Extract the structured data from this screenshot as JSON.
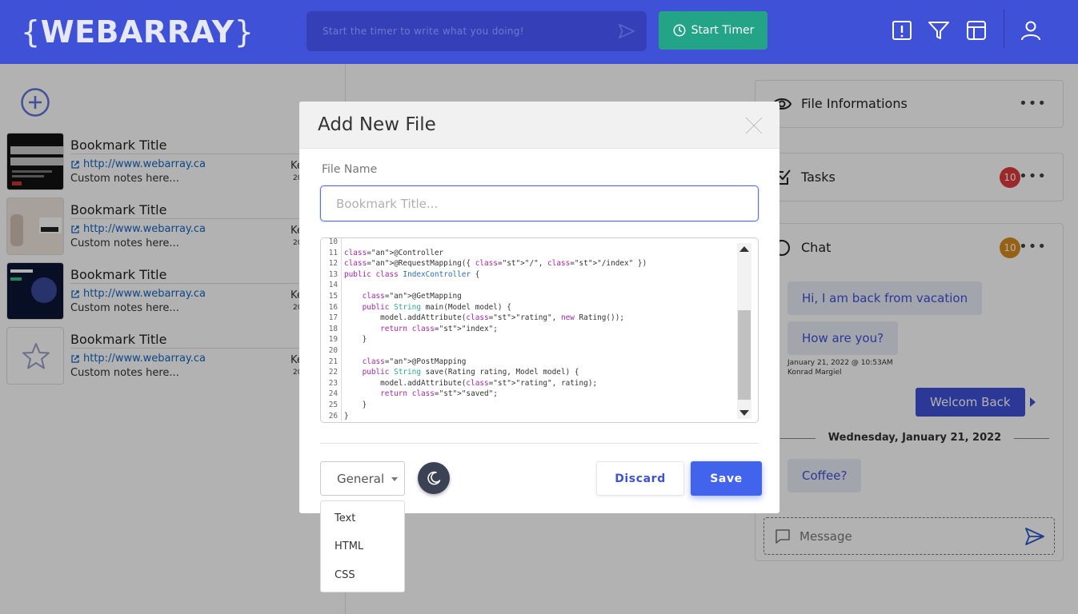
{
  "header": {
    "logo_text": "WEBARRAY",
    "logo_brace_open": "{",
    "logo_brace_close": "}",
    "timer_placeholder": "Start the timer to write what you doing!",
    "start_timer_label": "Start Timer",
    "colors": {
      "primary": "#3f51d6",
      "timer_button": "#23a487"
    },
    "icons": [
      "send-icon",
      "clock-icon",
      "alert-icon",
      "filter-icon",
      "layout-icon",
      "user-icon"
    ]
  },
  "bookmarks": [
    {
      "title": "Bookmark Title",
      "url": "http://www.webarray.ca",
      "notes": "Custom notes here...",
      "side": "Ke",
      "side2": "20",
      "thumb": "sports"
    },
    {
      "title": "Bookmark Title",
      "url": "http://www.webarray.ca",
      "notes": "Custom notes here...",
      "side": "Ke",
      "side2": "20",
      "thumb": "lifestyle"
    },
    {
      "title": "Bookmark Title",
      "url": "http://www.webarray.ca",
      "notes": "Custom notes here...",
      "side": "Ke",
      "side2": "20",
      "thumb": "space"
    },
    {
      "title": "Bookmark Title",
      "url": "http://www.webarray.ca",
      "notes": "Custom notes here...",
      "side": "Ke",
      "side2": "20",
      "thumb": "star"
    }
  ],
  "right_panel": {
    "file_info_title": "File Informations",
    "tasks_title": "Tasks",
    "tasks_badge": "10",
    "chat_title": "Chat",
    "chat_badge": "10",
    "more_label": "•••",
    "messages": [
      {
        "text": "Hi, I am back from vacation",
        "dir": "in"
      },
      {
        "text": "How are you?",
        "dir": "in"
      },
      {
        "text": "Welcom Back",
        "dir": "out"
      },
      {
        "text": "Coffee?",
        "dir": "in"
      }
    ],
    "meta_time": "January 21, 2022 @ 10:53AM",
    "meta_author": "Konrad Margiel",
    "date_separator": "Wednesday, January 21, 2022",
    "message_placeholder": "Message"
  },
  "modal": {
    "title": "Add New File",
    "file_name_label": "File Name",
    "file_name_placeholder": "Bookmark Title...",
    "code_lines": [
      {
        "n": "10",
        "t": ""
      },
      {
        "n": "11",
        "t": "@Controller"
      },
      {
        "n": "12",
        "t": "@RequestMapping({ \"/\", \"/index\" })"
      },
      {
        "n": "13",
        "t": "public class IndexController {"
      },
      {
        "n": "14",
        "t": ""
      },
      {
        "n": "15",
        "t": "    @GetMapping"
      },
      {
        "n": "16",
        "t": "    public String main(Model model) {"
      },
      {
        "n": "17",
        "t": "        model.addAttribute(\"rating\", new Rating());"
      },
      {
        "n": "18",
        "t": "        return \"index\";"
      },
      {
        "n": "19",
        "t": "    }"
      },
      {
        "n": "20",
        "t": ""
      },
      {
        "n": "21",
        "t": "    @PostMapping"
      },
      {
        "n": "22",
        "t": "    public String save(Rating rating, Model model) {"
      },
      {
        "n": "23",
        "t": "        model.addAttribute(\"rating\", rating);"
      },
      {
        "n": "24",
        "t": "        return \"saved\";"
      },
      {
        "n": "25",
        "t": "    }"
      },
      {
        "n": "26",
        "t": "}"
      }
    ],
    "type_selected": "General",
    "type_options": [
      "Text",
      "HTML",
      "CSS"
    ],
    "discard_label": "Discard",
    "save_label": "Save",
    "colors": {
      "save": "#4263eb",
      "theme_button": "#3b4253"
    }
  }
}
